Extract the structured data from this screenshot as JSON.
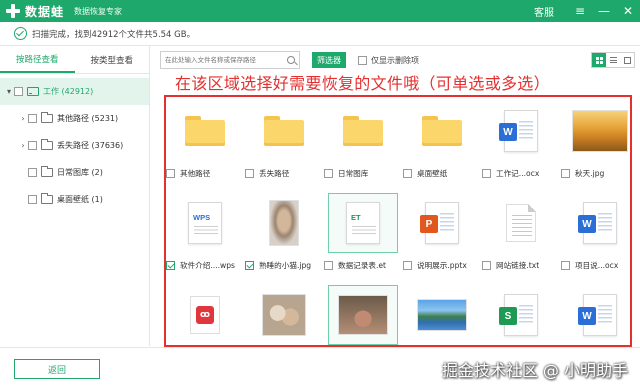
{
  "titlebar": {
    "app_name": "数据蛙",
    "app_subtitle": "数据恢复专家",
    "support_label": "客服",
    "menu_glyph": "≡",
    "minimize_glyph": "—",
    "close_glyph": "✕",
    "brand_color": "#1fa86b"
  },
  "status": {
    "text": "扫描完成，找到42912个文件共5.54 GB。"
  },
  "sidebar": {
    "tabs": [
      {
        "label": "按路径查看",
        "active": true
      },
      {
        "label": "按类型查看",
        "active": false
      }
    ],
    "tree": [
      {
        "label": "工作 (42912)",
        "arrow": "▾",
        "icon": "drive-icon",
        "checked": false
      },
      {
        "label": "其他路径 (5231)",
        "arrow": "›",
        "icon": "folder-icon",
        "checked": false
      },
      {
        "label": "丢失路径 (37636)",
        "arrow": "›",
        "icon": "folder-icon",
        "checked": false
      },
      {
        "label": "日常图库 (2)",
        "arrow": "",
        "icon": "folder-icon",
        "checked": false
      },
      {
        "label": "桌面壁纸 (1)",
        "arrow": "",
        "icon": "folder-icon",
        "checked": false
      }
    ]
  },
  "toolbar": {
    "search_placeholder": "在此处输入文件名称或保存路径",
    "filter_label": "筛选器",
    "deleted_only_label": "仅显示删除项"
  },
  "annotation": {
    "text": "在该区域选择好需要恢复的文件哦（可单选或多选）",
    "color": "#e53030"
  },
  "files": [
    {
      "name": "其他路径",
      "type": "folder",
      "checked": false
    },
    {
      "name": "丢失路径",
      "type": "folder",
      "checked": false
    },
    {
      "name": "日常图库",
      "type": "folder",
      "checked": false
    },
    {
      "name": "桌面壁纸",
      "type": "folder",
      "checked": false
    },
    {
      "name": "工作记...ocx",
      "type": "word",
      "checked": false
    },
    {
      "name": "秋天.jpg",
      "type": "photo-autumn",
      "checked": false
    },
    {
      "name": "软件介绍....wps",
      "type": "wps",
      "checked": true
    },
    {
      "name": "熟睡的小猫.jpg",
      "type": "photo-cat",
      "checked": true
    },
    {
      "name": "数据记录表.et",
      "type": "et",
      "checked": false
    },
    {
      "name": "说明展示.pptx",
      "type": "ppt",
      "checked": false
    },
    {
      "name": "网站链接.txt",
      "type": "txt",
      "checked": false
    },
    {
      "name": "项目说...ocx",
      "type": "word",
      "checked": false
    },
    {
      "name": "",
      "type": "pdf",
      "checked": false
    },
    {
      "name": "",
      "type": "photo-cats",
      "checked": false
    },
    {
      "name": "",
      "type": "photo-rabbit",
      "checked": false
    },
    {
      "name": "",
      "type": "photo-lake",
      "checked": false
    },
    {
      "name": "",
      "type": "sheet",
      "checked": false
    },
    {
      "name": "",
      "type": "word",
      "checked": false
    }
  ],
  "bottom": {
    "back_label": "返回",
    "watermark": "掘金技术社区 @ 小明助手"
  }
}
